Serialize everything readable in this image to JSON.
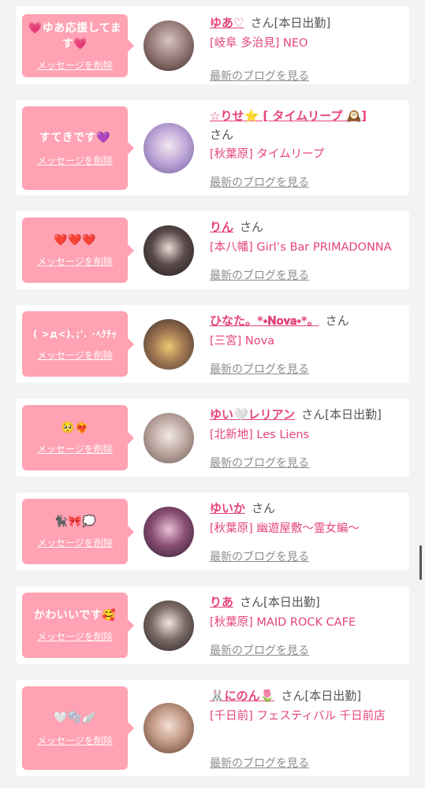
{
  "common": {
    "san": "さん",
    "delete_label": "メッセージを削除",
    "blog_label": "最新のブログを見る"
  },
  "colors": {
    "bubble": "#ffa2b3",
    "accent": "#e5447a",
    "muted": "#8d8d8d"
  },
  "items": [
    {
      "message": "💗ゆあ応援してます💗",
      "name": "ゆあ♡",
      "badge": "[本日出勤]",
      "shop": "[岐阜 多治見] NEO"
    },
    {
      "message": "すてきです💜",
      "name": "☆りせ⭐ [ タイムリープ 🕰️]",
      "badge": "",
      "shop": "[秋葉原] タイムリープ"
    },
    {
      "message": "❤️❤️❤️",
      "name": "りん",
      "badge": "",
      "shop": "[本八幡] Girl’s Bar PRIMADONNA"
    },
    {
      "message": "( >д<)､;'. ･ﾍｸﾁｯ",
      "name": "ひなた。*⬩𝐍𝐨𝐯𝐚⬩*。",
      "badge": "",
      "shop": "[三宮] Nova"
    },
    {
      "message": "🥺❤️‍🔥",
      "name": "ゆい🤍レリアン",
      "badge": "[本日出勤]",
      "shop": "[北新地] Les Liens"
    },
    {
      "message": "🐈‍⬛🎀💭",
      "name": "ゆいか",
      "badge": "",
      "shop": "[秋葉原] 幽遊屋敷〜霊女編〜"
    },
    {
      "message": "かわいいです🥰",
      "name": "りあ",
      "badge": "[本日出勤]",
      "shop": "[秋葉原] MAID ROCK CAFE"
    },
    {
      "message": "🤍🫧🪽",
      "name": "🐰にのん🌷",
      "badge": "[本日出勤]",
      "shop": "[千日前] フェスティバル 千日前店"
    }
  ]
}
